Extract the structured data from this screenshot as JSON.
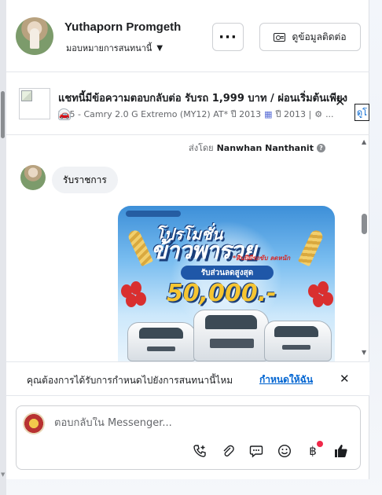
{
  "header": {
    "name": "Yuthaporn Promgeth",
    "assign_label": "มอบหมายการสนทนานี้",
    "more_label": "···",
    "contact_label": "ดูข้อมูลติดต่อ"
  },
  "listing": {
    "title": "แชทนี้มีข้อความตอบกลับต่อ รับรถ 1,999 บาท / ผ่อนเริ่มต้นเพียง",
    "sub_model": "Z45 - Camry 2.0 G Extremo (MY12) AT* ปี 2013",
    "sub_year": "ปี 2013 |",
    "sub_more": "...",
    "link_label": "ดูโ"
  },
  "messages": {
    "sent_by_prefix": "ส่งโดย",
    "sent_by_name": "Nanwhan Nanthanit",
    "incoming_text": "รับราชการ"
  },
  "promo": {
    "title_line1": "โปรโมชั่น",
    "title_line2": "ข้าวพารวย",
    "subtitle": "*สินปีมีรถขับ ลดหนัก",
    "ribbon": "รับส่วนลดสูงสุด",
    "amount": "50,000.-"
  },
  "suggestion": {
    "text": "คุณต้องการได้รับการกำหนดไปยังการสนทนานี้ไหม",
    "link": "กำหนดให้ฉัน",
    "close": "✕"
  },
  "composer": {
    "placeholder": "ตอบกลับใน Messenger...",
    "icons": [
      "call-add-icon",
      "attach-icon",
      "saved-reply-icon",
      "emoji-icon",
      "baht-icon",
      "like-icon"
    ]
  },
  "colors": {
    "link": "#0064d1",
    "bubble": "#f0f2f5",
    "badge": "#f02849"
  }
}
